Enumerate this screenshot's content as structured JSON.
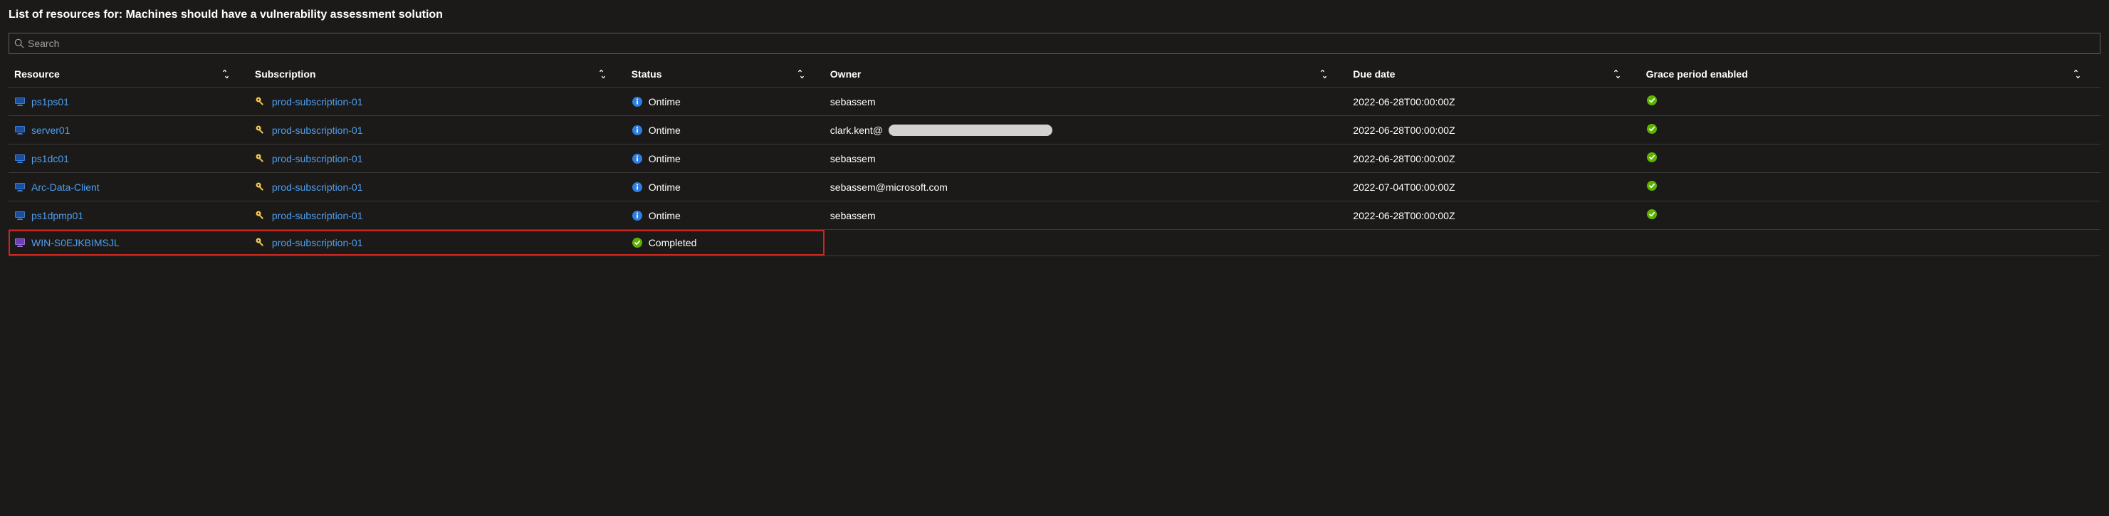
{
  "header": {
    "title": "List of resources for: Machines should have a vulnerability assessment solution"
  },
  "search": {
    "placeholder": "Search",
    "value": ""
  },
  "columns": {
    "resource": "Resource",
    "subscription": "Subscription",
    "status": "Status",
    "owner": "Owner",
    "due_date": "Due date",
    "grace": "Grace period enabled"
  },
  "status_labels": {
    "ontime": "Ontime",
    "completed": "Completed"
  },
  "rows": [
    {
      "resource": "ps1ps01",
      "resource_icon": "vm",
      "subscription": "prod-subscription-01",
      "status": "ontime",
      "owner": "sebassem",
      "owner_redacted": false,
      "due_date": "2022-06-28T00:00:00Z",
      "grace": true,
      "highlighted": false
    },
    {
      "resource": "server01",
      "resource_icon": "vm",
      "subscription": "prod-subscription-01",
      "status": "ontime",
      "owner": "clark.kent@",
      "owner_redacted": true,
      "due_date": "2022-06-28T00:00:00Z",
      "grace": true,
      "highlighted": false
    },
    {
      "resource": "ps1dc01",
      "resource_icon": "vm",
      "subscription": "prod-subscription-01",
      "status": "ontime",
      "owner": "sebassem",
      "owner_redacted": false,
      "due_date": "2022-06-28T00:00:00Z",
      "grace": true,
      "highlighted": false
    },
    {
      "resource": "Arc-Data-Client",
      "resource_icon": "vm",
      "subscription": "prod-subscription-01",
      "status": "ontime",
      "owner": "sebassem@microsoft.com",
      "owner_redacted": false,
      "due_date": "2022-07-04T00:00:00Z",
      "grace": true,
      "highlighted": false
    },
    {
      "resource": "ps1dpmp01",
      "resource_icon": "vm",
      "subscription": "prod-subscription-01",
      "status": "ontime",
      "owner": "sebassem",
      "owner_redacted": false,
      "due_date": "2022-06-28T00:00:00Z",
      "grace": true,
      "highlighted": false
    },
    {
      "resource": "WIN-S0EJKBIMSJL",
      "resource_icon": "arc",
      "subscription": "prod-subscription-01",
      "status": "completed",
      "owner": "",
      "owner_redacted": false,
      "due_date": "",
      "grace": false,
      "highlighted": true
    }
  ],
  "colors": {
    "link": "#4f9eed",
    "key": "#f2c94c",
    "info": "#2f7ee2",
    "success": "#5db300",
    "arc": "#9a6dd7",
    "highlight": "#c8281f"
  }
}
